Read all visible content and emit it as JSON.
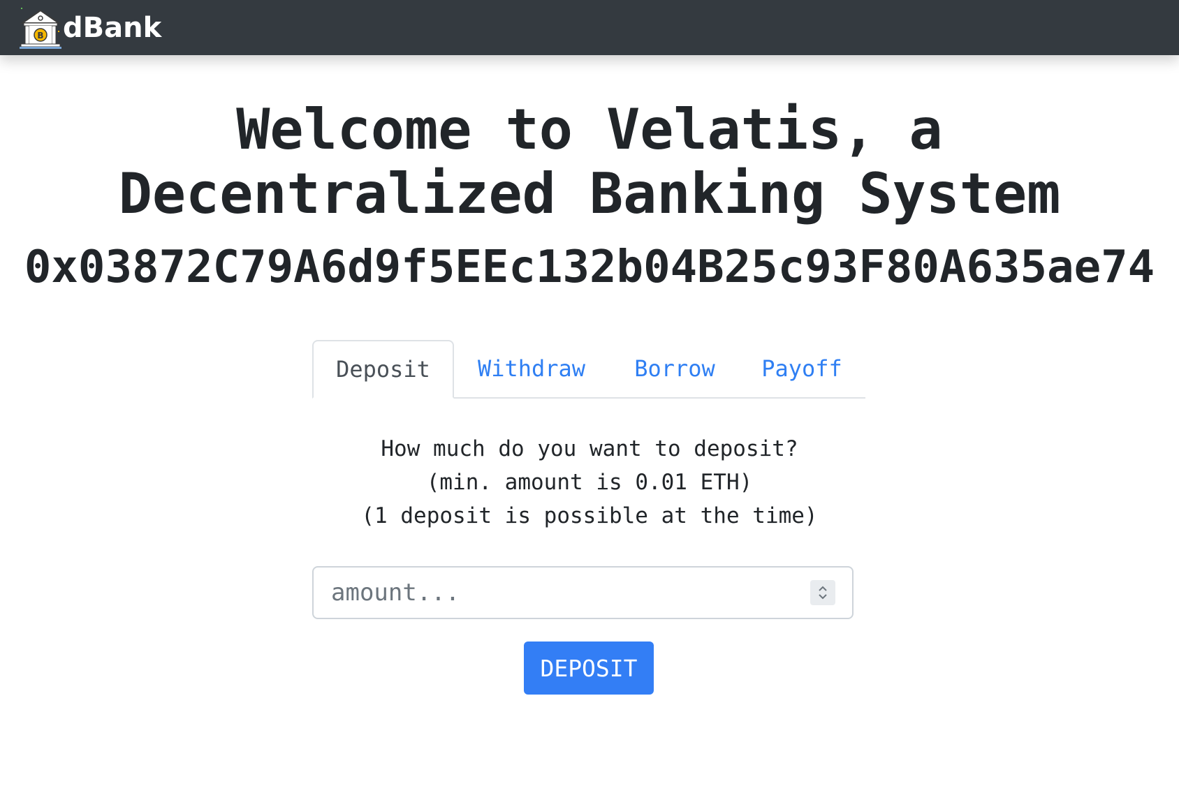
{
  "navbar": {
    "brand_name": "dBank",
    "logo_icon": "bank-bitcoin-icon",
    "background_color": "#343a40"
  },
  "hero": {
    "line1": "Welcome to Velatis, a",
    "line2": "Decentralized Banking System",
    "account_address": "0x03872C79A6d9f5EEc132b04B25c93F80A635ae74"
  },
  "tabs": [
    {
      "label": "Deposit",
      "active": true
    },
    {
      "label": "Withdraw",
      "active": false
    },
    {
      "label": "Borrow",
      "active": false
    },
    {
      "label": "Payoff",
      "active": false
    }
  ],
  "deposit": {
    "prompt_lines": [
      "How much do you want to deposit?",
      "(min. amount is 0.01 ETH)",
      "(1 deposit is possible at the time)"
    ],
    "amount_placeholder": "amount...",
    "amount_value": "",
    "button_label": "DEPOSIT"
  },
  "colors": {
    "accent": "#337ef5",
    "tab_link": "#2f7ff3",
    "text": "#212529"
  }
}
